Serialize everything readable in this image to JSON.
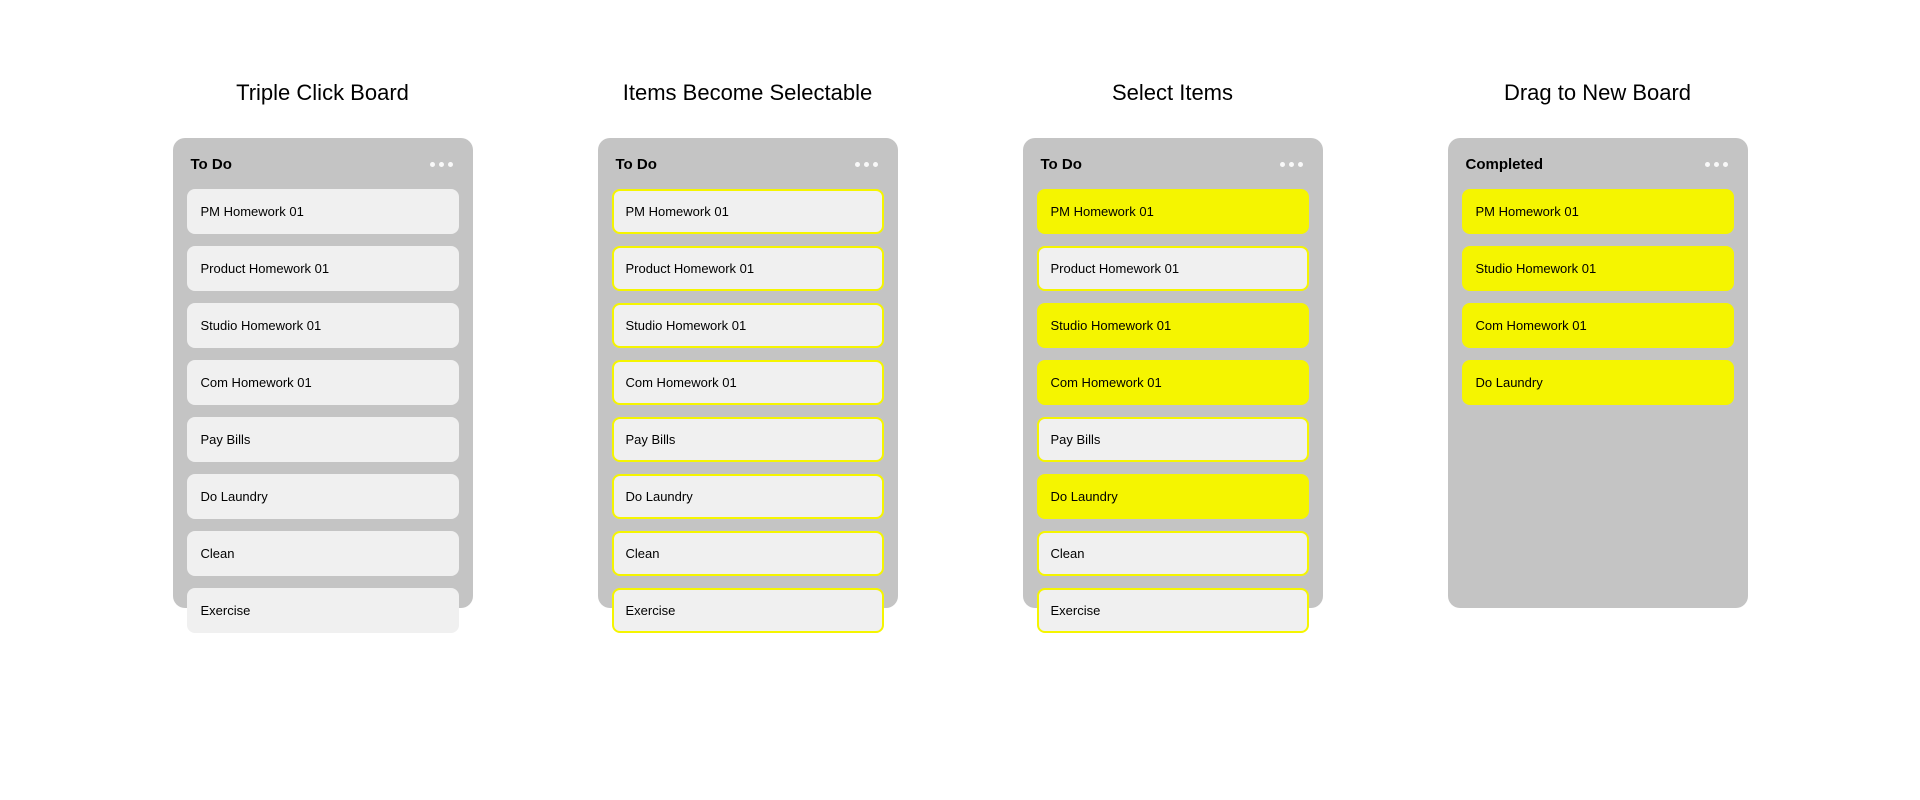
{
  "columns": [
    {
      "title": "Triple Click Board",
      "board_title": "To Do",
      "cards": [
        {
          "label": "PM Homework 01",
          "state": "normal"
        },
        {
          "label": "Product Homework 01",
          "state": "normal"
        },
        {
          "label": "Studio Homework 01",
          "state": "normal"
        },
        {
          "label": "Com Homework 01",
          "state": "normal"
        },
        {
          "label": "Pay Bills",
          "state": "normal"
        },
        {
          "label": "Do Laundry",
          "state": "normal"
        },
        {
          "label": "Clean",
          "state": "normal"
        },
        {
          "label": "Exercise",
          "state": "normal"
        }
      ]
    },
    {
      "title": "Items Become Selectable",
      "board_title": "To Do",
      "cards": [
        {
          "label": "PM Homework 01",
          "state": "selectable"
        },
        {
          "label": "Product Homework 01",
          "state": "selectable"
        },
        {
          "label": "Studio Homework 01",
          "state": "selectable"
        },
        {
          "label": "Com Homework 01",
          "state": "selectable"
        },
        {
          "label": "Pay Bills",
          "state": "selectable"
        },
        {
          "label": "Do Laundry",
          "state": "selectable"
        },
        {
          "label": "Clean",
          "state": "selectable"
        },
        {
          "label": "Exercise",
          "state": "selectable"
        }
      ]
    },
    {
      "title": "Select Items",
      "board_title": "To Do",
      "cards": [
        {
          "label": "PM Homework 01",
          "state": "selected"
        },
        {
          "label": "Product Homework 01",
          "state": "selectable"
        },
        {
          "label": "Studio Homework 01",
          "state": "selected"
        },
        {
          "label": "Com Homework 01",
          "state": "selected"
        },
        {
          "label": "Pay Bills",
          "state": "selectable"
        },
        {
          "label": "Do Laundry",
          "state": "selected"
        },
        {
          "label": "Clean",
          "state": "selectable"
        },
        {
          "label": "Exercise",
          "state": "selectable"
        }
      ]
    },
    {
      "title": "Drag to New Board",
      "board_title": "Completed",
      "cards": [
        {
          "label": "PM Homework 01",
          "state": "selected"
        },
        {
          "label": "Studio Homework 01",
          "state": "selected"
        },
        {
          "label": "Com Homework 01",
          "state": "selected"
        },
        {
          "label": "Do Laundry",
          "state": "selected"
        }
      ]
    }
  ]
}
